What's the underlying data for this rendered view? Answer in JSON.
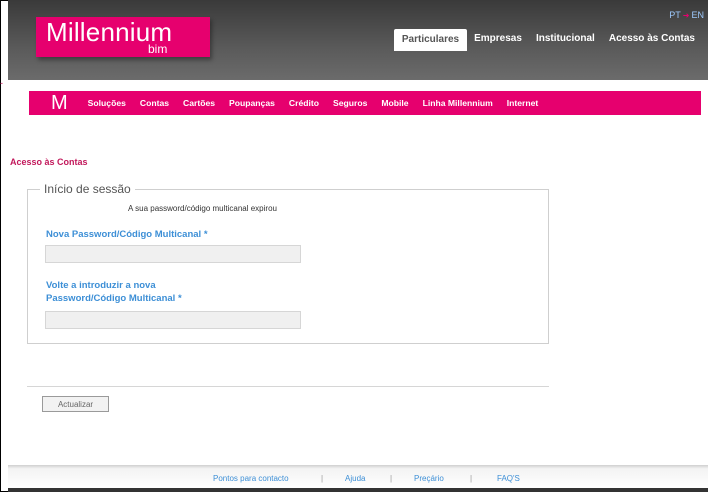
{
  "header": {
    "logo_text": "Millennium",
    "logo_sub": "bim",
    "lang_pt": "PT",
    "lang_en": "EN",
    "top_nav": [
      "Particulares",
      "Empresas",
      "Institucional",
      "Acesso às Contas"
    ]
  },
  "main_nav": {
    "logo_glyph": "M",
    "items": [
      "Soluções",
      "Contas",
      "Cartões",
      "Poupanças",
      "Crédito",
      "Seguros",
      "Mobile",
      "Linha Millennium",
      "Internet"
    ]
  },
  "breadcrumb": "Acesso às Contas",
  "login": {
    "legend": "Início de sessão",
    "message": "A sua password/código multicanal expirou",
    "new_password_label": "Nova Password/Código Multicanal *",
    "new_password_value": "",
    "confirm_label_line1": "Volte a introduzir a nova",
    "confirm_label_line2": "Password/Código Multicanal *",
    "confirm_value": ""
  },
  "button": {
    "update": "Actualizar"
  },
  "footer": [
    "Pontos para contacto",
    "Ajuda",
    "Preçário",
    "FAQ'S"
  ],
  "colors": {
    "brand": "#e6006e",
    "link": "#3d8fd6",
    "header": "#4a4a4a"
  }
}
